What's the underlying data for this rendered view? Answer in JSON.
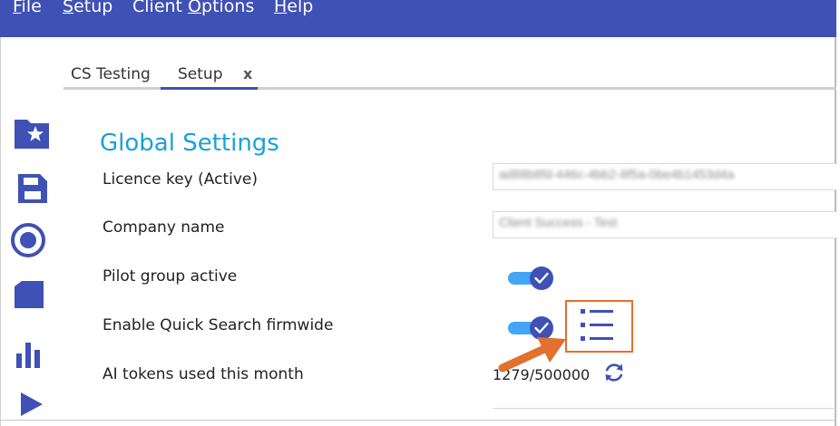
{
  "menu": {
    "file": {
      "key": "F",
      "rest": "ile"
    },
    "setup": {
      "key": "S",
      "rest": "etup"
    },
    "client_options": {
      "pre": "Client ",
      "key": "O",
      "rest": "ptions"
    },
    "help": {
      "key": "H",
      "rest": "elp"
    }
  },
  "tabs": [
    {
      "label": "CS Testing"
    },
    {
      "label": "Setup",
      "close": "x"
    }
  ],
  "sidebar": {
    "icons": [
      "folder-star-icon",
      "save-icon",
      "record-icon",
      "folder-icon",
      "bar-chart-icon",
      "play-icon"
    ]
  },
  "main": {
    "title": "Global Settings",
    "settings": {
      "licence_key": {
        "label": "Licence key (Active)",
        "value": "ad88b8fd-446c-4bb2-8f5a-0be4b1453d4a"
      },
      "company_name": {
        "label": "Company name",
        "value": "Client Success - Test"
      },
      "pilot_group": {
        "label": "Pilot group active",
        "enabled": true
      },
      "quick_search": {
        "label": "Enable Quick Search firmwide",
        "enabled": true
      },
      "ai_tokens": {
        "label": "AI tokens used this month",
        "value": "1279/500000"
      }
    }
  },
  "colors": {
    "menubar": "#3f51b5",
    "title": "#1aa1d8",
    "toggle_track": "#42a5f5",
    "toggle_knob": "#3f51b5",
    "annotation": "#e2702e"
  },
  "annotation": {
    "icon": "arrow-annotation-icon",
    "target": "quick-search-options-icon"
  }
}
